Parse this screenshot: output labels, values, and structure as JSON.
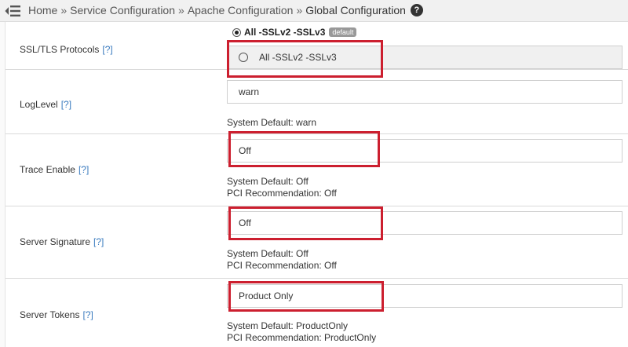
{
  "breadcrumb": {
    "items": [
      "Home",
      "Service Configuration",
      "Apache Configuration"
    ],
    "separator": "»",
    "current": "Global Configuration",
    "help_glyph": "?"
  },
  "icons": {
    "menu": "menu-collapse-icon",
    "help": "help-circle-icon"
  },
  "colors": {
    "highlight": "#cc1f2f",
    "link": "#3a7bbf",
    "badge": "#999999"
  },
  "help_link": "[?]",
  "settings": {
    "ssl": {
      "label": "SSL/TLS Protocols",
      "default_option": "All -SSLv2 -SSLv3",
      "default_badge": "default",
      "custom_option": "All -SSLv2 -SSLv3"
    },
    "loglevel": {
      "label": "LogLevel",
      "value": "warn",
      "system_default": "System Default: warn"
    },
    "trace": {
      "label": "Trace Enable",
      "value": "Off",
      "system_default": "System Default: Off",
      "pci": "PCI Recommendation: Off"
    },
    "signature": {
      "label": "Server Signature",
      "value": "Off",
      "system_default": "System Default: Off",
      "pci": "PCI Recommendation: Off"
    },
    "tokens": {
      "label": "Server Tokens",
      "value": "Product Only",
      "system_default": "System Default: ProductOnly",
      "pci": "PCI Recommendation: ProductOnly"
    }
  }
}
